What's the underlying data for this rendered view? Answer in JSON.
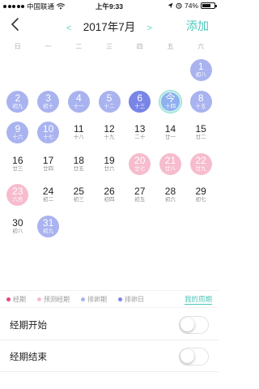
{
  "status_bar": {
    "carrier": "中国联通",
    "time": "上午9:33",
    "battery": "74%",
    "battery_level": 0.74
  },
  "nav": {
    "title": "2017年7月",
    "add_label": "添加",
    "prev_label": "<",
    "next_label": ">"
  },
  "weekdays": [
    "日",
    "一",
    "二",
    "三",
    "四",
    "五",
    "六"
  ],
  "calendar": {
    "weeks": [
      [
        null,
        null,
        null,
        null,
        null,
        null,
        {
          "day": "1",
          "lunar": "初八",
          "state": "ovulation"
        }
      ],
      [
        {
          "day": "2",
          "lunar": "初九",
          "state": "ovulation"
        },
        {
          "day": "3",
          "lunar": "初十",
          "state": "ovulation"
        },
        {
          "day": "4",
          "lunar": "十一",
          "state": "ovulation"
        },
        {
          "day": "5",
          "lunar": "十二",
          "state": "ovulation"
        },
        {
          "day": "6",
          "lunar": "十三",
          "state": "ovday"
        },
        {
          "day": "今",
          "lunar": "十四",
          "state": "today"
        },
        {
          "day": "8",
          "lunar": "十五",
          "state": "ovulation"
        }
      ],
      [
        {
          "day": "9",
          "lunar": "十六",
          "state": "ovulation"
        },
        {
          "day": "10",
          "lunar": "十七",
          "state": "ovulation"
        },
        {
          "day": "11",
          "lunar": "十八",
          "state": ""
        },
        {
          "day": "12",
          "lunar": "十九",
          "state": ""
        },
        {
          "day": "13",
          "lunar": "二十",
          "state": ""
        },
        {
          "day": "14",
          "lunar": "廿一",
          "state": ""
        },
        {
          "day": "15",
          "lunar": "廿二",
          "state": ""
        }
      ],
      [
        {
          "day": "16",
          "lunar": "廿三",
          "state": ""
        },
        {
          "day": "17",
          "lunar": "廿四",
          "state": ""
        },
        {
          "day": "18",
          "lunar": "廿五",
          "state": ""
        },
        {
          "day": "19",
          "lunar": "廿六",
          "state": ""
        },
        {
          "day": "20",
          "lunar": "廿七",
          "state": "predicted"
        },
        {
          "day": "21",
          "lunar": "廿八",
          "state": "predicted"
        },
        {
          "day": "22",
          "lunar": "廿九",
          "state": "predicted"
        }
      ],
      [
        {
          "day": "23",
          "lunar": "六月",
          "state": "predicted"
        },
        {
          "day": "24",
          "lunar": "初二",
          "state": ""
        },
        {
          "day": "25",
          "lunar": "初三",
          "state": ""
        },
        {
          "day": "26",
          "lunar": "初四",
          "state": ""
        },
        {
          "day": "27",
          "lunar": "初五",
          "state": ""
        },
        {
          "day": "28",
          "lunar": "初六",
          "state": ""
        },
        {
          "day": "29",
          "lunar": "初七",
          "state": ""
        }
      ],
      [
        {
          "day": "30",
          "lunar": "初八",
          "state": ""
        },
        {
          "day": "31",
          "lunar": "初九",
          "state": "ovulation"
        },
        null,
        null,
        null,
        null,
        null
      ]
    ]
  },
  "legend": {
    "items": [
      {
        "label": "经期",
        "color": "#e8457a"
      },
      {
        "label": "预测经期",
        "color": "#f6bccd"
      },
      {
        "label": "排卵期",
        "color": "#a9b3ef"
      },
      {
        "label": "排卵日",
        "color": "#7885e6"
      }
    ],
    "my_cycle": "我的周期"
  },
  "settings": [
    {
      "label": "经期开始",
      "on": false
    },
    {
      "label": "经期结束",
      "on": false
    }
  ],
  "colors": {
    "accent": "#4dc8ba",
    "ovulation": "#a9b3ef",
    "ovulation_day": "#7885e6",
    "predicted_period": "#f6bccd"
  }
}
